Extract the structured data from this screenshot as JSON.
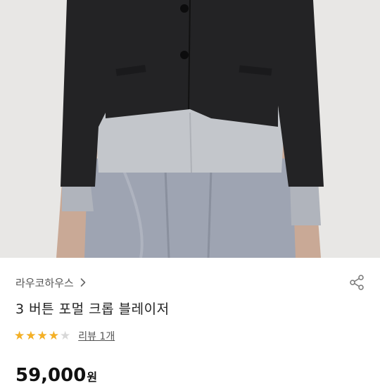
{
  "product": {
    "brand": "라우코하우스",
    "title": "3 버튼 포멀 크롭 블레이저",
    "rating": 4,
    "rating_max": 5,
    "review_label": "리뷰 1개",
    "price": "59,000",
    "currency_unit": "원"
  },
  "icons": {
    "brand_chevron": "chevron-right-icon",
    "share": "share-icon",
    "star": "star-icon"
  },
  "colors": {
    "star_filled": "#f5b024",
    "star_empty": "#d8d8d8",
    "text_primary": "#222222",
    "text_secondary": "#555555"
  }
}
